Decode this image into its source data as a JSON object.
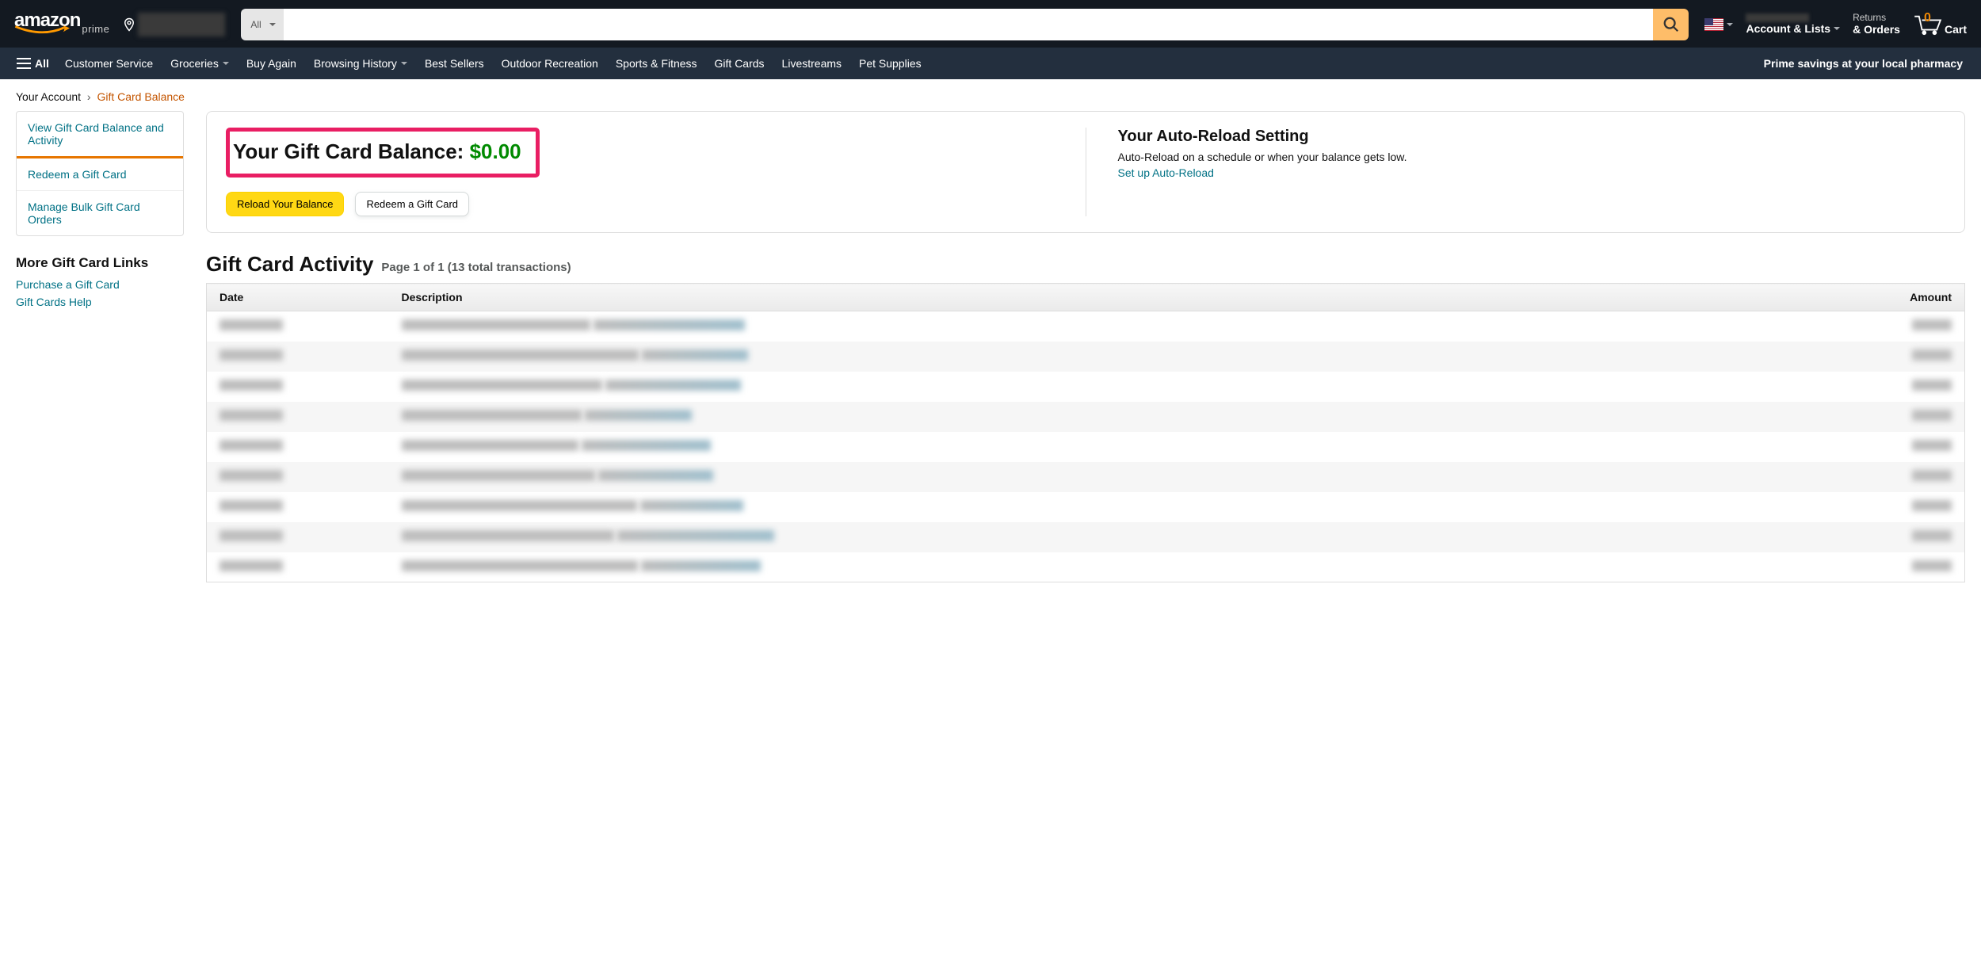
{
  "header": {
    "logo_word": "amazon",
    "logo_sub": "prime",
    "search_scope": "All",
    "account_line1_redacted": true,
    "account_line2": "Account & Lists",
    "returns_line1": "Returns",
    "returns_line2": "& Orders",
    "cart_count": "0",
    "cart_label": "Cart"
  },
  "subnav": {
    "all": "All",
    "items": [
      "Customer Service",
      "Groceries",
      "Buy Again",
      "Browsing History",
      "Best Sellers",
      "Outdoor Recreation",
      "Sports & Fitness",
      "Gift Cards",
      "Livestreams",
      "Pet Supplies"
    ],
    "items_dropdown": [
      false,
      true,
      false,
      true,
      false,
      false,
      false,
      false,
      false,
      false
    ],
    "promo": "Prime savings at your local pharmacy"
  },
  "breadcrumb": {
    "root": "Your Account",
    "current": "Gift Card Balance"
  },
  "sidebar": {
    "items": [
      {
        "label": "View Gift Card Balance and Activity",
        "active": true
      },
      {
        "label": "Redeem a Gift Card",
        "active": false
      },
      {
        "label": "Manage Bulk Gift Card Orders",
        "active": false
      }
    ],
    "more_title": "More Gift Card Links",
    "more_links": [
      "Purchase a Gift Card",
      "Gift Cards Help"
    ]
  },
  "balance_panel": {
    "title_prefix": "Your Gift Card Balance: ",
    "amount": "$0.00",
    "reload_btn": "Reload Your Balance",
    "redeem_btn": "Redeem a Gift Card",
    "auto_title": "Your Auto-Reload Setting",
    "auto_desc": "Auto-Reload on a schedule or when your balance gets low.",
    "auto_link": "Set up Auto-Reload"
  },
  "activity": {
    "title": "Gift Card Activity",
    "pager": "Page 1 of 1 (13 total transactions)",
    "columns": [
      "Date",
      "Description",
      "Amount"
    ],
    "rows_visible": 9,
    "rows_redacted": true
  }
}
